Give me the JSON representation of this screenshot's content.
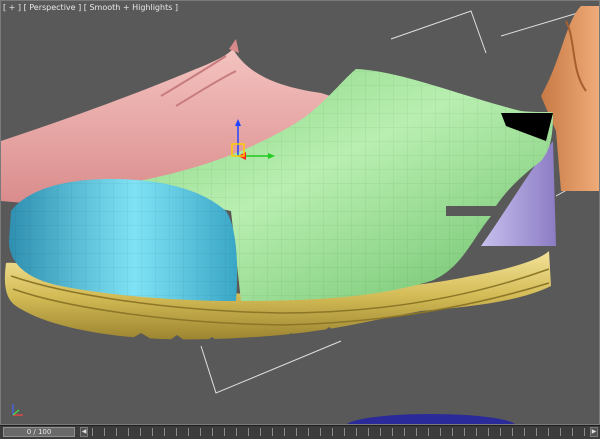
{
  "viewport": {
    "label": "[ + ] [ Perspective ] [ Smooth + Highlights ]"
  },
  "timeline": {
    "frame_display": "0 / 100"
  },
  "colors": {
    "viewport_bg": "#595959",
    "green_upper": "#8fd98f",
    "blue_toecap": "#4cb8d8",
    "yellow_sole": "#d9c463",
    "pink_shoe": "#e8a5a5",
    "purple_heel": "#a99ad6",
    "orange_shoe": "#d98a52",
    "dark_blue_shadow": "#2a2a9a"
  },
  "icons": {
    "move_gizmo": "move-gizmo-icon",
    "world_axis": "world-axis-icon"
  }
}
